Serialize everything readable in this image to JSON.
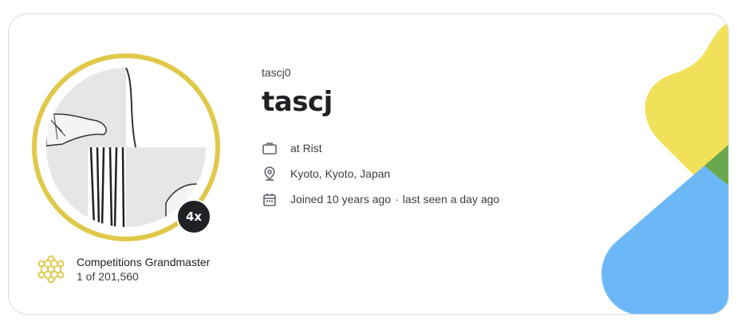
{
  "profile": {
    "username": "tascj0",
    "display_name": "tascj",
    "tier_badge": "4x",
    "organization": "at Rist",
    "location": "Kyoto, Kyoto, Japan",
    "joined": "Joined 10 years ago",
    "separator": "·",
    "last_seen": "last seen a day ago"
  },
  "rank": {
    "title": "Competitions Grandmaster",
    "position": "1 of 201,560"
  },
  "icons": {
    "organization": "briefcase-icon",
    "location": "location-pin-icon",
    "joined": "calendar-icon",
    "rank": "grandmaster-tier-icon"
  },
  "colors": {
    "tier_gold": "#e0c94a",
    "deco_yellow": "#f1e05a",
    "deco_blue": "#6cb8f7",
    "deco_green": "#6aa84f",
    "badge_bg": "#202124"
  }
}
